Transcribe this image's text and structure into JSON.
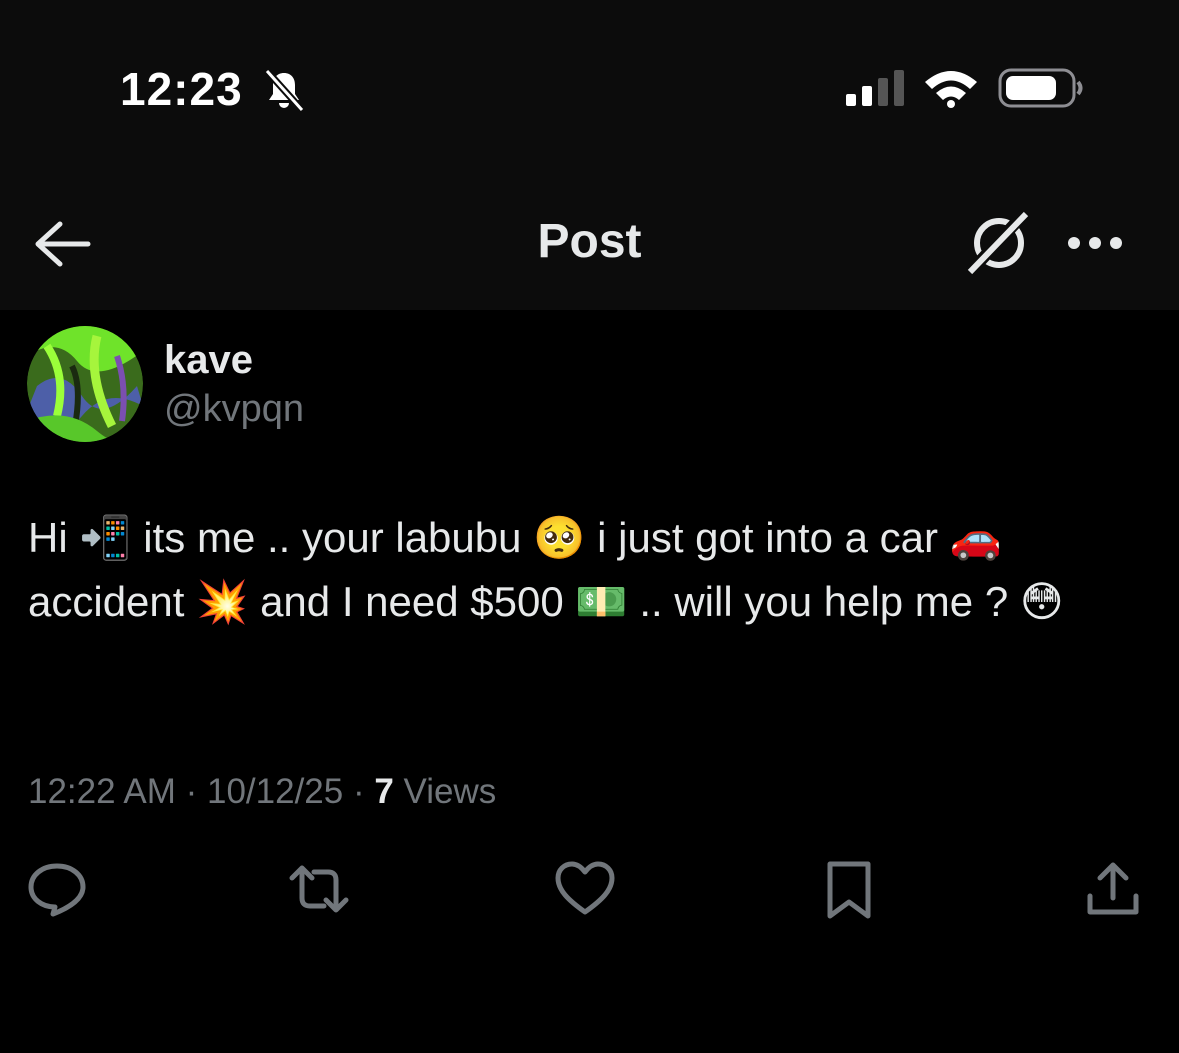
{
  "status_bar": {
    "time": "12:23",
    "icons": [
      "bell-slash-icon",
      "cellular-signal-icon",
      "wifi-icon",
      "battery-icon"
    ]
  },
  "nav": {
    "title": "Post",
    "icons": [
      "back-arrow-icon",
      "grok-icon",
      "more-icon"
    ]
  },
  "author": {
    "display_name": "kave",
    "handle": "@kvpqn"
  },
  "post": {
    "segments": [
      "Hi ",
      "📲",
      " its me .. your labubu ",
      "🥺",
      " i just got into a car ",
      "🚗",
      " accident ",
      "💥",
      " and I need $500 ",
      "💵",
      " .. will you help me ? ",
      "😳"
    ]
  },
  "meta": {
    "time": "12:22 AM",
    "sep1": " · ",
    "date": "10/12/25",
    "sep2": " · ",
    "views_count": "7",
    "views_label": " Views"
  },
  "actions": [
    "reply-icon",
    "repost-icon",
    "like-icon",
    "bookmark-icon",
    "share-icon"
  ],
  "colors": {
    "background": "#000000",
    "header": "#0c0c0c",
    "text": "#e7e9ea",
    "secondary": "#71767b"
  }
}
